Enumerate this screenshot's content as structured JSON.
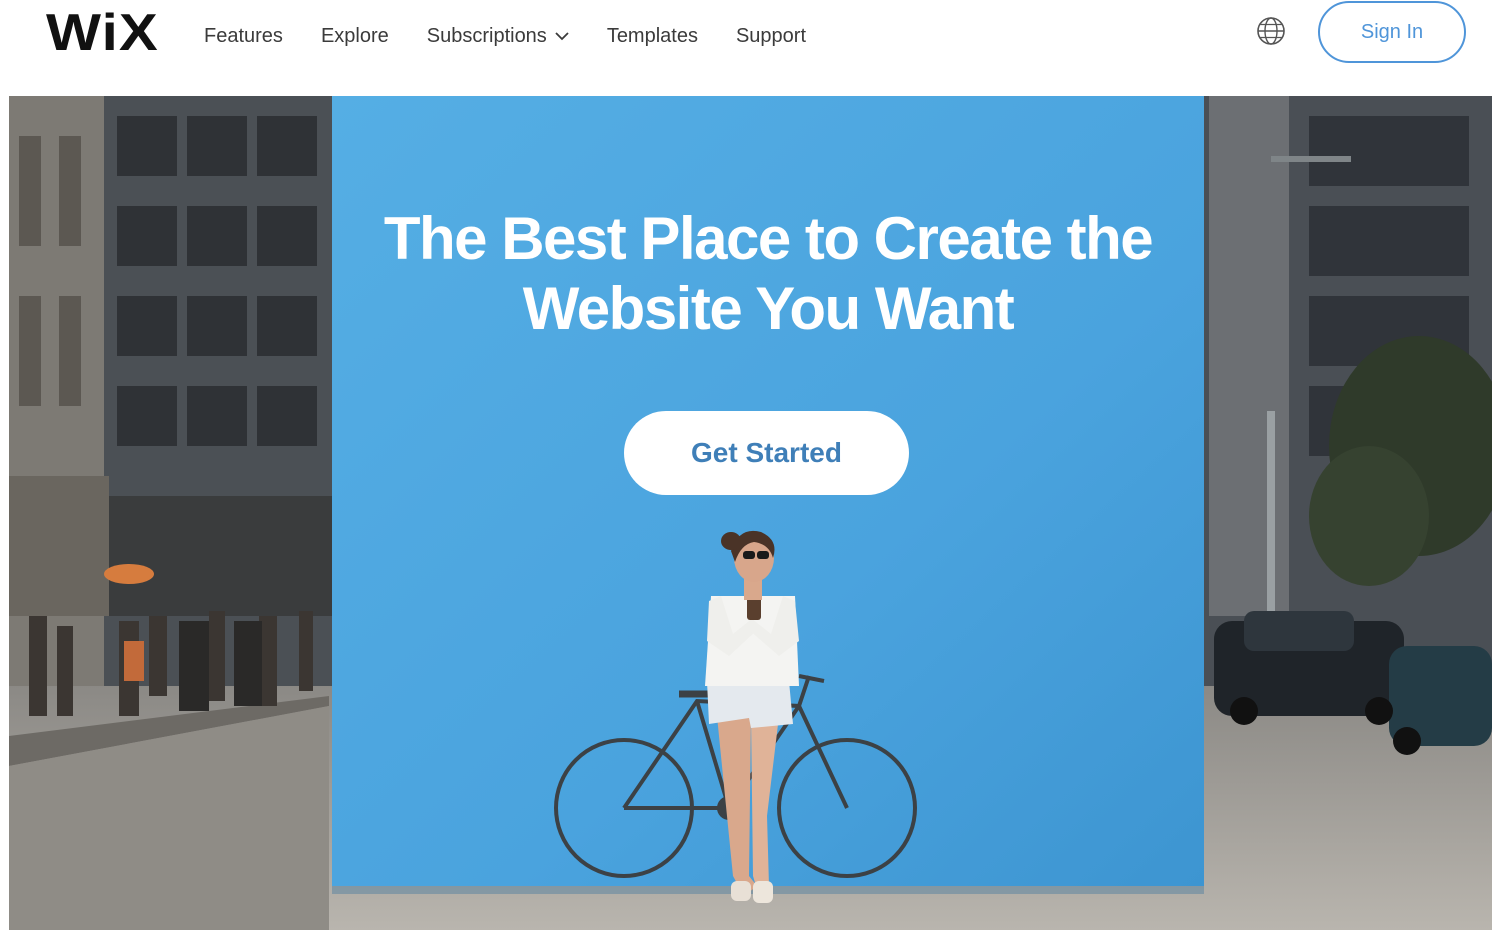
{
  "header": {
    "logo": "WiX",
    "nav": [
      {
        "label": "Features",
        "has_dropdown": false
      },
      {
        "label": "Explore",
        "has_dropdown": false
      },
      {
        "label": "Subscriptions",
        "has_dropdown": true
      },
      {
        "label": "Templates",
        "has_dropdown": false
      },
      {
        "label": "Support",
        "has_dropdown": false
      }
    ],
    "language_icon": "globe-icon",
    "sign_in_label": "Sign In"
  },
  "hero": {
    "headline_line1": "The Best Place to Create the",
    "headline_line2": "Website You Want",
    "cta_label": "Get Started"
  },
  "colors": {
    "accent_blue": "#4f95d9",
    "hero_blue": "#4aa3de",
    "cta_text": "#3f7fb8",
    "logo": "#111111"
  }
}
